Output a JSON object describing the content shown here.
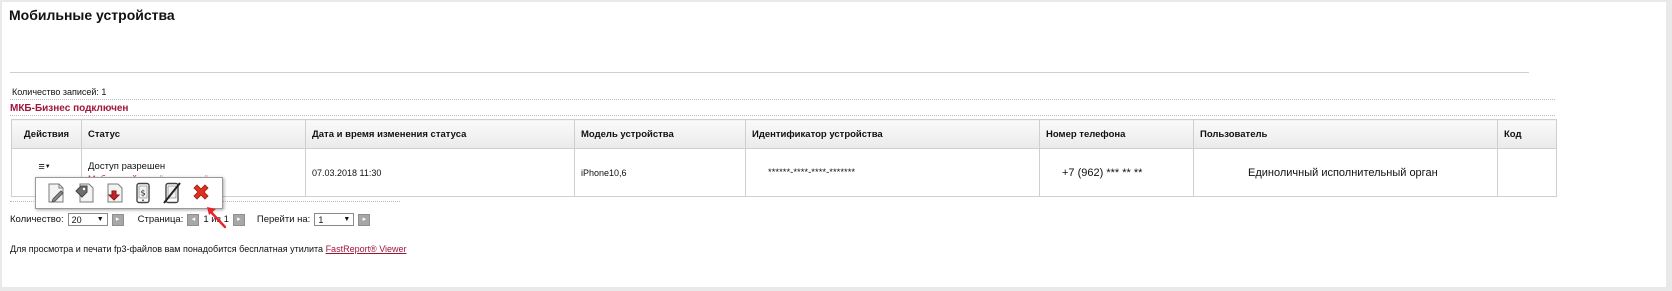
{
  "page": {
    "title": "Мобильные устройства",
    "records_label": "Количество записей: 1",
    "section_title": "МКБ-Бизнес подключен"
  },
  "table": {
    "headers": [
      "Действия",
      "Статус",
      "Дата и время изменения статуса",
      "Модель устройства",
      "Идентификатор устройства",
      "Номер телефона",
      "Пользователь",
      "Код"
    ],
    "rows": [
      {
        "actions_glyph": "≡",
        "status_primary": "Доступ разрешен",
        "status_secondary": "Мобильный платёж запрещён",
        "changed_at": "07.03.2018 11:30",
        "device_model": "iPhone10,6",
        "device_id": "******-****-****-*******",
        "phone": "+7 (962) *** ** **",
        "user": "Единоличный исполнительный орган",
        "code": ""
      }
    ]
  },
  "popup_menu": {
    "items": [
      {
        "icon": "edit-document-icon"
      },
      {
        "icon": "tag-icon"
      },
      {
        "icon": "export-document-icon"
      },
      {
        "icon": "mobile-payment-icon"
      },
      {
        "icon": "block-mobile-icon"
      },
      {
        "icon": "delete-icon"
      }
    ]
  },
  "pager": {
    "count_label": "Количество:",
    "count_value": "20",
    "page_label": "Страница:",
    "page_value": "1 из 1",
    "goto_label": "Перейти на:",
    "goto_value": "1"
  },
  "footer": {
    "note": "Для просмотра и печати fp3-файлов вам понадобится бесплатная утилита ",
    "link": "FastReport® Viewer"
  },
  "colors": {
    "accent": "#a0163b",
    "danger": "#d2242a",
    "arrow": "#e8232a"
  }
}
